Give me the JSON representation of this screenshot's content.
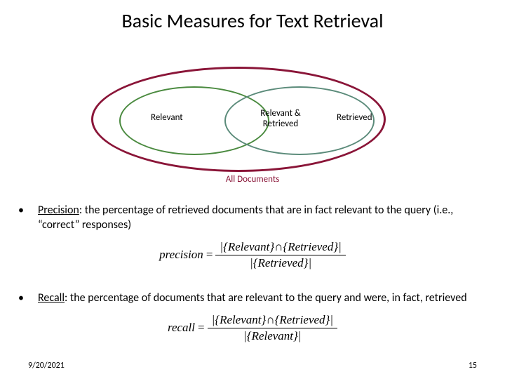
{
  "title": "Basic Measures for Text Retrieval",
  "diagram": {
    "left_label": "Relevant",
    "center_label": "Relevant & Retrieved",
    "right_label": "Retrieved",
    "outer_label": "All Documents"
  },
  "precision": {
    "label": "Precision",
    "rest": ": the percentage of retrieved documents that are in fact relevant to the query (i.e., “correct” responses)",
    "formula": {
      "lhs": "precision",
      "numerator": "|{Relevant}∩{Retrieved}|",
      "denominator": "|{Retrieved}|"
    }
  },
  "recall": {
    "label": "Recall",
    "rest": ": the percentage of documents that are relevant to the query and were, in fact, retrieved",
    "formula": {
      "lhs": "recall",
      "numerator": "|{Relevant}∩{Retrieved}|",
      "denominator": "|{Relevant}|"
    }
  },
  "footer": {
    "date": "9/20/2021",
    "page": "15"
  }
}
